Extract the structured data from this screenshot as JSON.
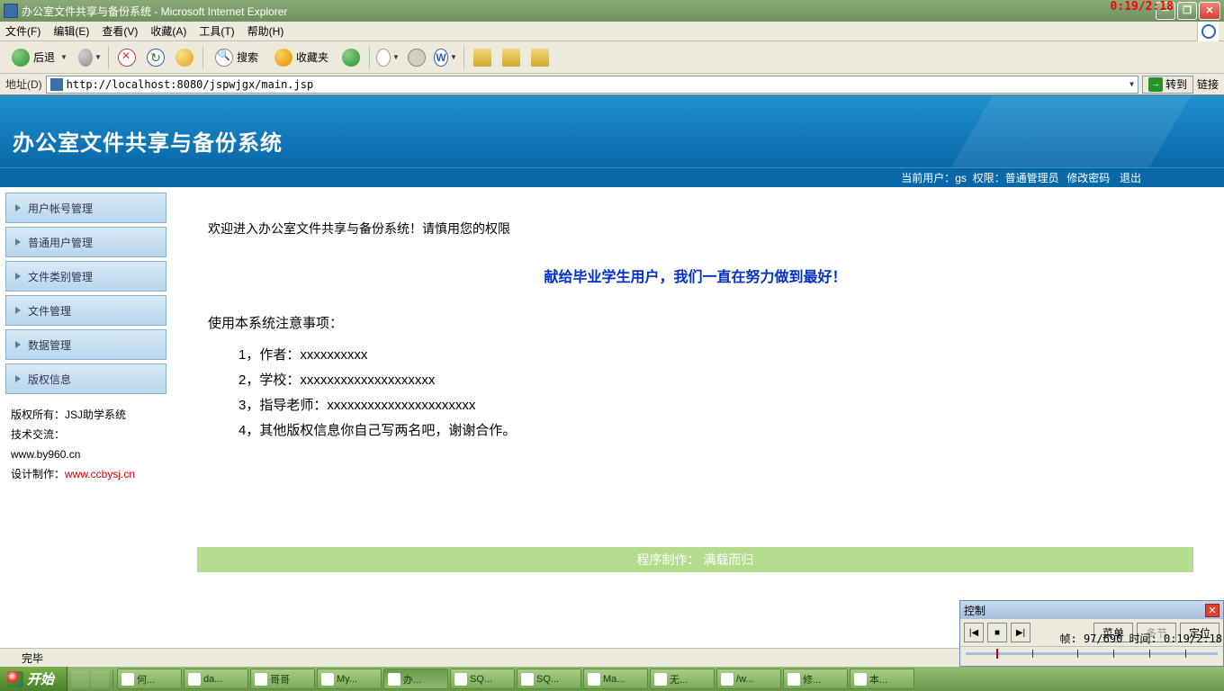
{
  "timecode": "0:19/2:18",
  "window": {
    "title": "办公室文件共享与备份系统 - Microsoft Internet Explorer"
  },
  "menus": [
    "文件(F)",
    "编辑(E)",
    "查看(V)",
    "收藏(A)",
    "工具(T)",
    "帮助(H)"
  ],
  "toolbar": {
    "back": "后退",
    "search": "搜索",
    "favorites": "收藏夹"
  },
  "address": {
    "label": "地址(D)",
    "url": "http://localhost:8080/jspwjgx/main.jsp",
    "go": "转到",
    "links": "链接"
  },
  "app": {
    "title": "办公室文件共享与备份系统",
    "userbar": {
      "current_user_label": "当前用户：",
      "user": "gs",
      "perm_label": "权限：",
      "perm": "普通管理员",
      "changepw": "修改密码",
      "logout": "退出"
    }
  },
  "sidebar": {
    "items": [
      {
        "label": "用户帐号管理"
      },
      {
        "label": "普通用户管理"
      },
      {
        "label": "文件类别管理"
      },
      {
        "label": "文件管理"
      },
      {
        "label": "数据管理"
      },
      {
        "label": "版权信息"
      }
    ],
    "copyright": {
      "l1": "版权所有：JSJ助学系统",
      "l2": "技术交流：",
      "l3": "www.by960.cn",
      "l4a": "设计制作：",
      "l4b": "www.ccbysj.cn"
    }
  },
  "content": {
    "welcome": "欢迎进入办公室文件共享与备份系统！请慎用您的权限",
    "dedication": "献给毕业学生用户，我们一直在努力做到最好！",
    "notice_title": "使用本系统注意事项：",
    "notices": [
      "1，作者：xxxxxxxxxx",
      "2，学校：xxxxxxxxxxxxxxxxxxxx",
      "3，指导老师：xxxxxxxxxxxxxxxxxxxxxx",
      "4，其他版权信息你自己写两名吧，谢谢合作。"
    ],
    "footer": "程序制作： 满载而归"
  },
  "status": {
    "text": "完毕"
  },
  "control": {
    "title": "控制",
    "menu": "菜单",
    "multi": "多节",
    "locate": "定位",
    "frameinfo": "帧: 97/690 时间: 0:19/2:18"
  },
  "taskbar": {
    "start": "开始",
    "tasks": [
      "何...",
      "da...",
      "哥哥",
      "My...",
      "办...",
      "SQ...",
      "SQ...",
      "Ma...",
      "无...",
      "/w...",
      "修...",
      "本..."
    ]
  }
}
